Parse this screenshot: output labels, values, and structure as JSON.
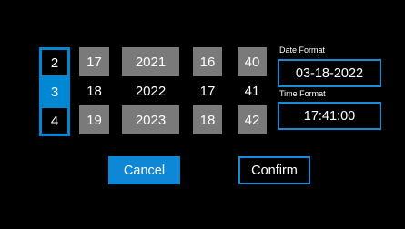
{
  "picker": {
    "month": [
      "2",
      "3",
      "4"
    ],
    "day": [
      "17",
      "18",
      "19"
    ],
    "year": [
      "2021",
      "2022",
      "2023"
    ],
    "hour": [
      "16",
      "17",
      "18"
    ],
    "minute": [
      "40",
      "41",
      "42"
    ]
  },
  "date_format": {
    "label": "Date Format",
    "value": "03-18-2022"
  },
  "time_format": {
    "label": "Time Format",
    "value": "17:41:00"
  },
  "buttons": {
    "cancel": "Cancel",
    "confirm": "Confirm"
  },
  "colors": {
    "accent": "#0e87d6",
    "cell_grey": "#7a7a7a",
    "background": "#000000"
  }
}
